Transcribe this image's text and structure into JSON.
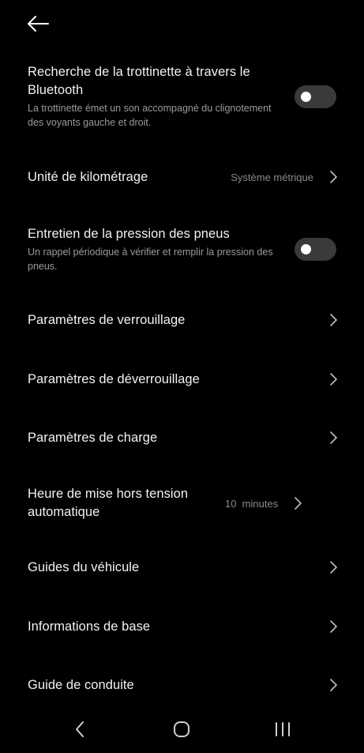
{
  "header": {
    "back_icon": "arrow-left-icon"
  },
  "settings": {
    "bluetooth_search": {
      "title": "Recherche de la trottinette à travers le Bluetooth",
      "description": "La trottinette émet un son accompagné du clignotement des voyants gauche et droit.",
      "enabled": false
    },
    "mileage_unit": {
      "title": "Unité de kilométrage",
      "value": "Système métrique"
    },
    "tire_pressure": {
      "title": "Entretien de la pression des pneus",
      "description": "Un rappel périodique à vérifier et remplir la pression des pneus.",
      "enabled": false
    },
    "lock_settings": {
      "title": "Paramètres de verrouillage"
    },
    "unlock_settings": {
      "title": "Paramètres de déverrouillage"
    },
    "charge_settings": {
      "title": "Paramètres de charge"
    },
    "auto_power_off": {
      "title": "Heure de mise hors tension automatique",
      "value": "10  minutes"
    },
    "vehicle_guides": {
      "title": "Guides du véhicule"
    },
    "basic_info": {
      "title": "Informations de base"
    },
    "riding_guide": {
      "title": "Guide de conduite"
    }
  },
  "navbar": {
    "back_icon": "nav-back-icon",
    "home_icon": "nav-home-icon",
    "recents_icon": "nav-recents-icon"
  },
  "colors": {
    "background": "#000000",
    "title_text": "#f2f2f2",
    "secondary_text": "#9a9a9a",
    "value_text": "#8a8a8a",
    "toggle_off_track": "#3a3a3a",
    "chevron": "#bdbdbd"
  }
}
